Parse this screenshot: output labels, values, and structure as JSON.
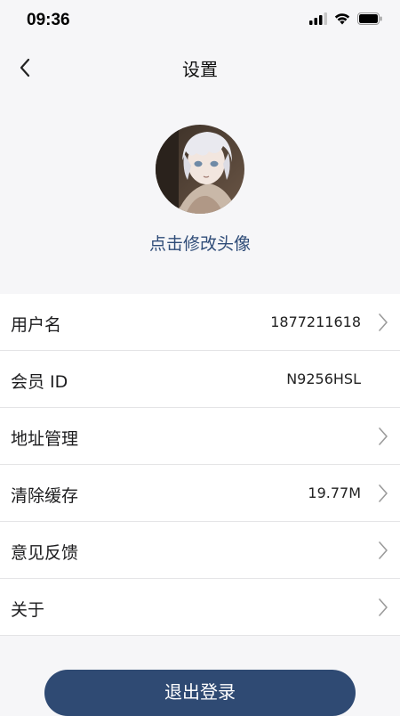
{
  "status_bar": {
    "time": "09:36",
    "icons": [
      "signal-icon",
      "wifi-icon",
      "battery-icon"
    ]
  },
  "nav": {
    "title": "设置",
    "back_icon": "chevron-left-icon"
  },
  "profile": {
    "avatar_description": "anime character with white hair",
    "change_avatar_label": "点击修改头像"
  },
  "settings": [
    {
      "label": "用户名",
      "value": "1877211618",
      "chevron": true
    },
    {
      "label": "会员 ID",
      "value": "N9256HSL",
      "chevron": false
    },
    {
      "label": "地址管理",
      "value": "",
      "chevron": true
    },
    {
      "label": "清除缓存",
      "value": "19.77M",
      "chevron": true
    },
    {
      "label": "意见反馈",
      "value": "",
      "chevron": true
    },
    {
      "label": "关于",
      "value": "",
      "chevron": true
    }
  ],
  "logout_label": "退出登录",
  "colors": {
    "accent": "#2f4a73",
    "link": "#2f4c78",
    "background": "#f6f6f8"
  }
}
